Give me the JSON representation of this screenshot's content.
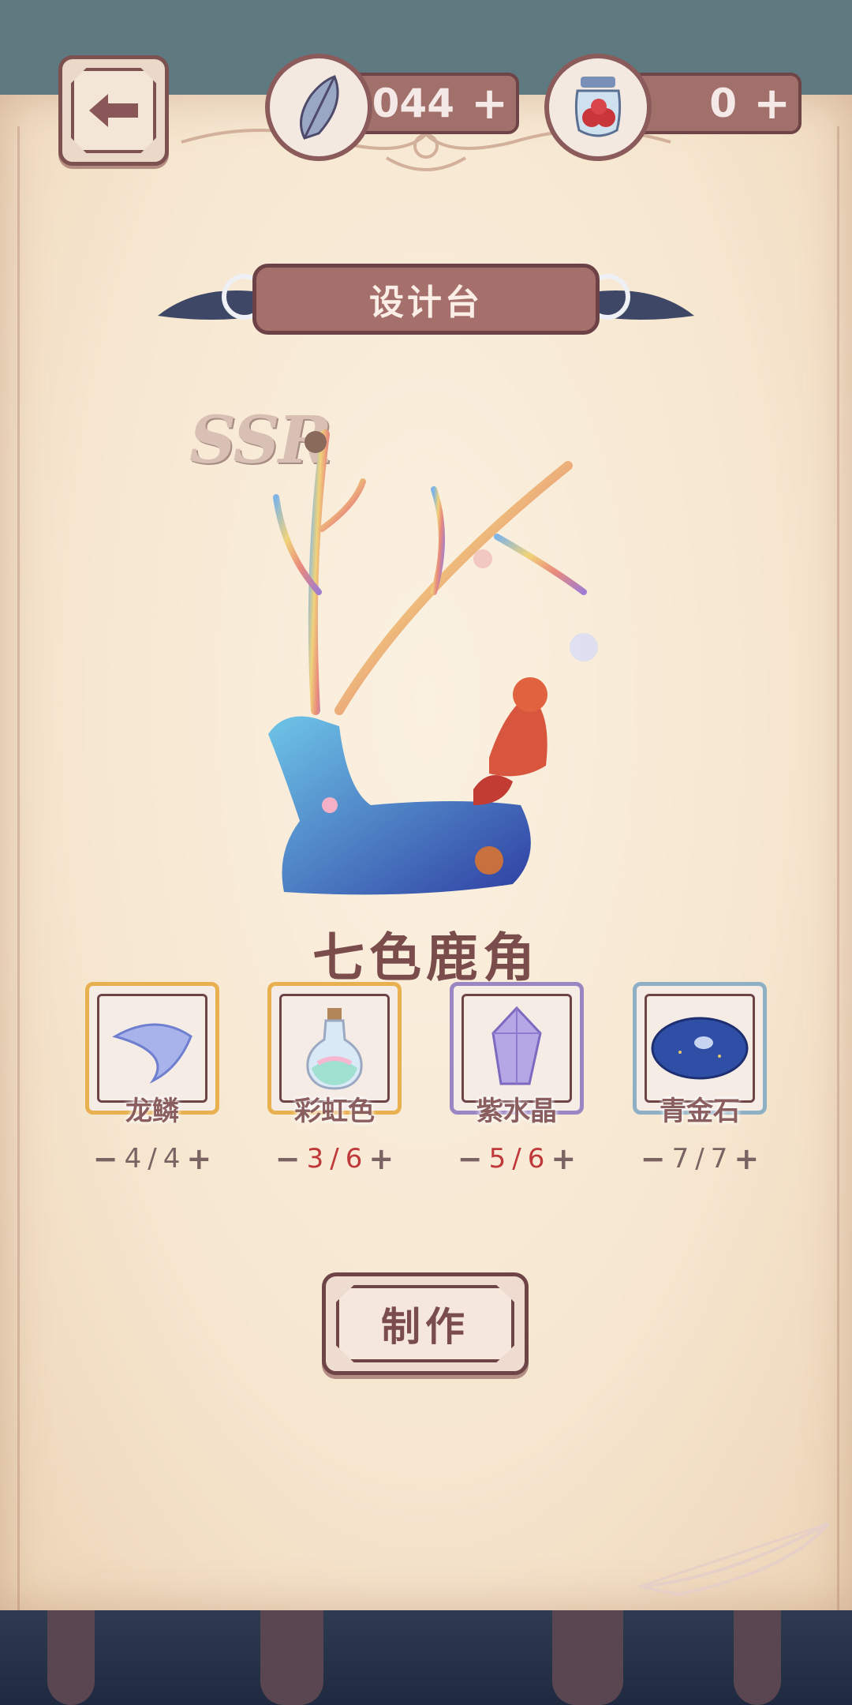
{
  "header": {
    "feather_currency": "4044",
    "berry_currency": "0",
    "plus_label": "+"
  },
  "page": {
    "title": "设计台"
  },
  "item": {
    "rarity": "SSR",
    "name": "七色鹿角"
  },
  "materials": [
    {
      "name": "龙鳞",
      "current": "4",
      "required": "4",
      "frame_color": "#e8b04e",
      "icon": "dragon-scale-icon",
      "short": false
    },
    {
      "name": "彩虹色",
      "current": "3",
      "required": "6",
      "frame_color": "#e8b04e",
      "icon": "rainbow-potion-icon",
      "short": true
    },
    {
      "name": "紫水晶",
      "current": "5",
      "required": "6",
      "frame_color": "#9b86c4",
      "icon": "amethyst-icon",
      "short": true
    },
    {
      "name": "青金石",
      "current": "7",
      "required": "7",
      "frame_color": "#8fb0c4",
      "icon": "lapis-lazuli-icon",
      "short": false
    }
  ],
  "actions": {
    "craft_label": "制作"
  },
  "counter": {
    "minus": "−",
    "plus": "+",
    "sep": "/"
  },
  "colors": {
    "accent": "#a56f6b",
    "text_brown": "#7a4c4c",
    "shortage_red": "#c0393a"
  }
}
